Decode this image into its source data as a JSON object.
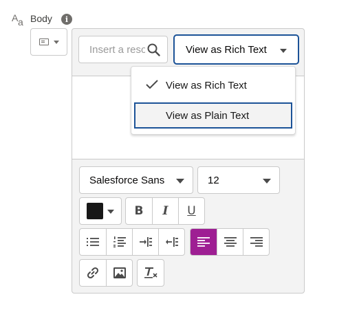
{
  "field": {
    "label": "Body",
    "info_icon": "info-icon",
    "type_icon": "text-field-icon"
  },
  "editor": {
    "search": {
      "placeholder": "Insert a resource",
      "value": "",
      "icon": "search-icon"
    },
    "view_select": {
      "selected": "View as Rich Text",
      "options": [
        {
          "label": "View as Rich Text",
          "checked": true
        },
        {
          "label": "View as Plain Text",
          "checked": false,
          "focused": true
        }
      ]
    },
    "toolbar": {
      "font": {
        "selected": "Salesforce Sans"
      },
      "size": {
        "selected": "12"
      },
      "text_color": "#181818",
      "format_buttons": [
        {
          "icon": "bold-icon",
          "glyph": "B"
        },
        {
          "icon": "italic-icon",
          "glyph": "I"
        },
        {
          "icon": "underline-icon",
          "glyph": "U"
        }
      ],
      "list_buttons": [
        {
          "icon": "bulleted-list-icon"
        },
        {
          "icon": "numbered-list-icon"
        },
        {
          "icon": "indent-icon"
        },
        {
          "icon": "outdent-icon"
        }
      ],
      "align_buttons": [
        {
          "icon": "align-left-icon",
          "active": true
        },
        {
          "icon": "align-center-icon",
          "active": false
        },
        {
          "icon": "align-right-icon",
          "active": false
        }
      ],
      "insert_buttons": [
        {
          "icon": "link-icon"
        },
        {
          "icon": "image-icon"
        }
      ],
      "clear_button": {
        "icon": "clear-formatting-icon"
      }
    }
  },
  "colors": {
    "focus_border": "#1b5297",
    "active_align": "#9e1f93",
    "panel_bg": "#f3f3f3",
    "border": "#c9c9c9"
  }
}
